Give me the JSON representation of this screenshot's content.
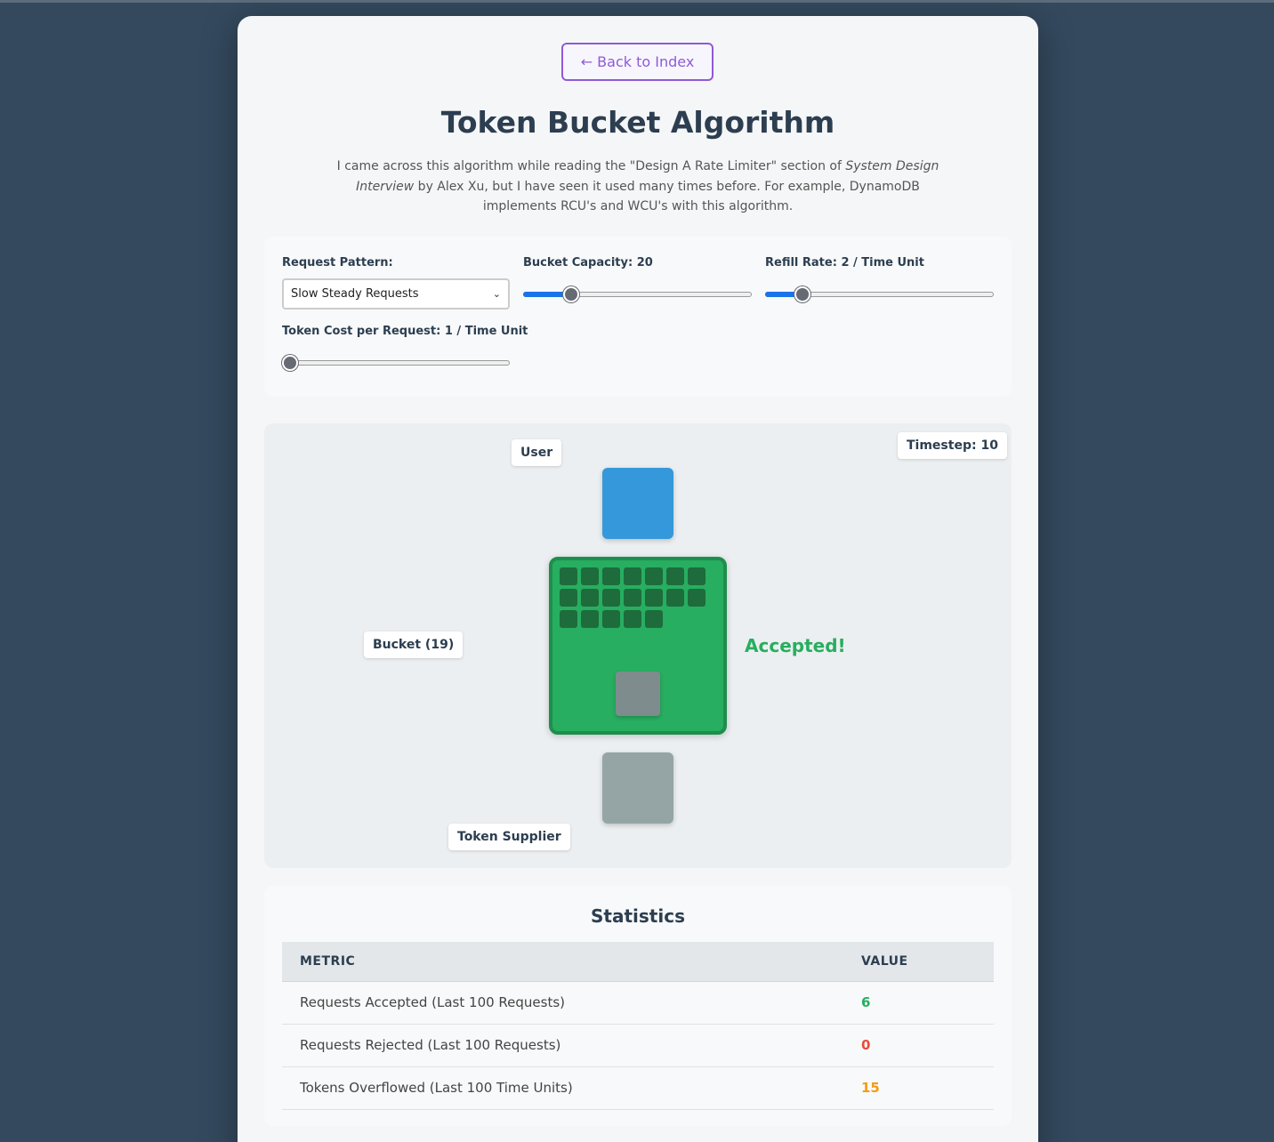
{
  "nav": {
    "back_label": "← Back to Index"
  },
  "header": {
    "title": "Token Bucket Algorithm",
    "intro_before": "I came across this algorithm while reading the \"Design A Rate Limiter\" section of ",
    "intro_book": "System Design Interview",
    "intro_after": " by Alex Xu, but I have seen it used many times before. For example, DynamoDB implements RCU's and WCU's with this algorithm."
  },
  "controls": {
    "pattern_label": "Request Pattern:",
    "pattern_value": "Slow Steady Requests",
    "capacity_label": "Bucket Capacity: 20",
    "capacity_fraction": 0.19,
    "refill_label": "Refill Rate: 2 / Time Unit",
    "refill_fraction": 0.14,
    "cost_label": "Token Cost per Request: 1 / Time Unit",
    "cost_fraction": 0.0
  },
  "visualization": {
    "user_label": "User",
    "timestep_label": "Timestep: 10",
    "bucket_label": "Bucket (19)",
    "token_count": 19,
    "status_text": "Accepted!",
    "supplier_label": "Token Supplier",
    "colors": {
      "user": "#3498db",
      "bucket": "#27ae60",
      "token": "#1e6b3c",
      "supplier": "#95a5a6",
      "request": "#7f8c8d"
    }
  },
  "stats": {
    "title": "Statistics",
    "headers": [
      "METRIC",
      "VALUE"
    ],
    "rows": [
      {
        "metric": "Requests Accepted (Last 100 Requests)",
        "value": "6",
        "color": "#27ae60"
      },
      {
        "metric": "Requests Rejected (Last 100 Requests)",
        "value": "0",
        "color": "#e74c3c"
      },
      {
        "metric": "Tokens Overflowed (Last 100 Time Units)",
        "value": "15",
        "color": "#f39c12"
      }
    ]
  }
}
